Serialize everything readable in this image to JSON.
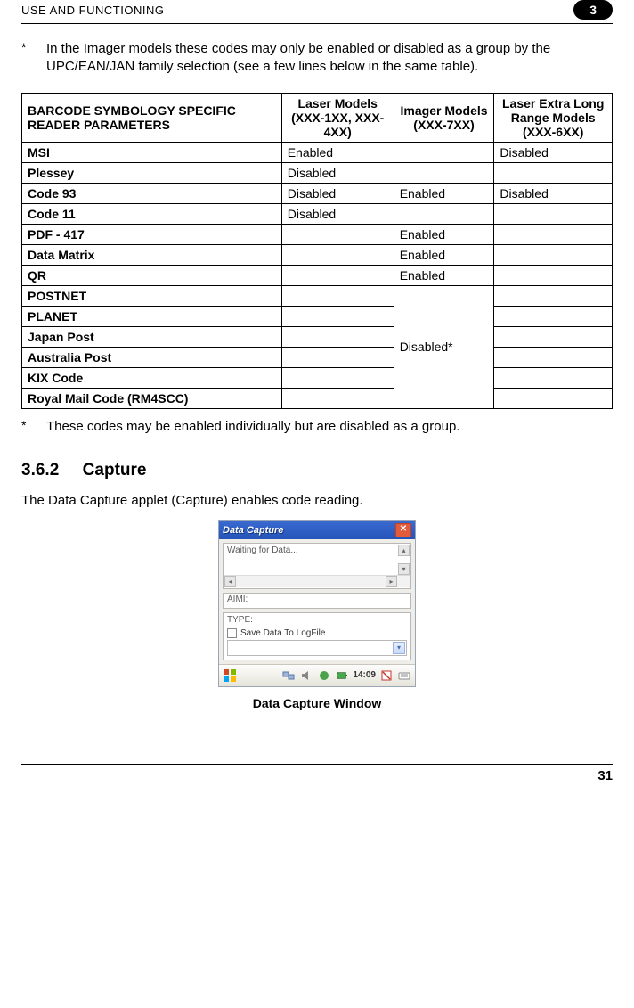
{
  "header": {
    "title": "USE AND FUNCTIONING",
    "chapter": "3"
  },
  "top_note": {
    "star": "*",
    "text": "In the Imager models these codes may only be enabled or disabled as a group by the UPC/EAN/JAN family selection (see a few lines below in the same table)."
  },
  "table": {
    "headers": {
      "sym": "BARCODE SYMBOLOGY SPECIFIC READER PARAMETERS",
      "laser": "Laser Models (XXX-1XX, XXX-4XX)",
      "imager": "Imager Models (XXX-7XX)",
      "extra": "Laser Extra Long Range Models (XXX-6XX)"
    },
    "rows": {
      "msi": {
        "name": "MSI",
        "laser": "Enabled",
        "imager": "",
        "extra": "Disabled"
      },
      "plessey": {
        "name": "Plessey",
        "laser": "Disabled",
        "imager": "",
        "extra": ""
      },
      "code93": {
        "name": "Code 93",
        "laser": "Disabled",
        "imager": "Enabled",
        "extra": "Disabled"
      },
      "code11": {
        "name": "Code 11",
        "laser": "Disabled",
        "imager": "",
        "extra": ""
      },
      "pdf417": {
        "name": "PDF - 417",
        "laser": "",
        "imager": "Enabled",
        "extra": ""
      },
      "datamatrix": {
        "name": "Data Matrix",
        "laser": "",
        "imager": "Enabled",
        "extra": ""
      },
      "qr": {
        "name": "QR",
        "laser": "",
        "imager": "Enabled",
        "extra": ""
      },
      "postnet": {
        "name": "POSTNET",
        "laser": "",
        "extra": ""
      },
      "planet": {
        "name": "PLANET",
        "laser": "",
        "extra": ""
      },
      "japanpost": {
        "name": "Japan Post",
        "laser": "",
        "extra": ""
      },
      "australia": {
        "name": "Australia Post",
        "laser": "",
        "extra": ""
      },
      "kix": {
        "name": "KIX Code",
        "laser": "",
        "extra": ""
      },
      "royal": {
        "name": "Royal Mail Code (RM4SCC)",
        "laser": "",
        "extra": ""
      },
      "disabled_group": "Disabled*"
    }
  },
  "bottom_note": {
    "star": "*",
    "text": "These codes may be enabled individually but are disabled as a group."
  },
  "section": {
    "number": "3.6.2",
    "title": "Capture",
    "body": "The Data Capture applet (Capture) enables code reading."
  },
  "capture_window": {
    "title": "Data Capture",
    "waiting": "Waiting for Data...",
    "aimi": "AIMI:",
    "type": "TYPE:",
    "checkbox": "Save Data To LogFile",
    "taskbar": {
      "clock": "14:09"
    }
  },
  "figure_caption": "Data Capture Window",
  "page_number": "31"
}
